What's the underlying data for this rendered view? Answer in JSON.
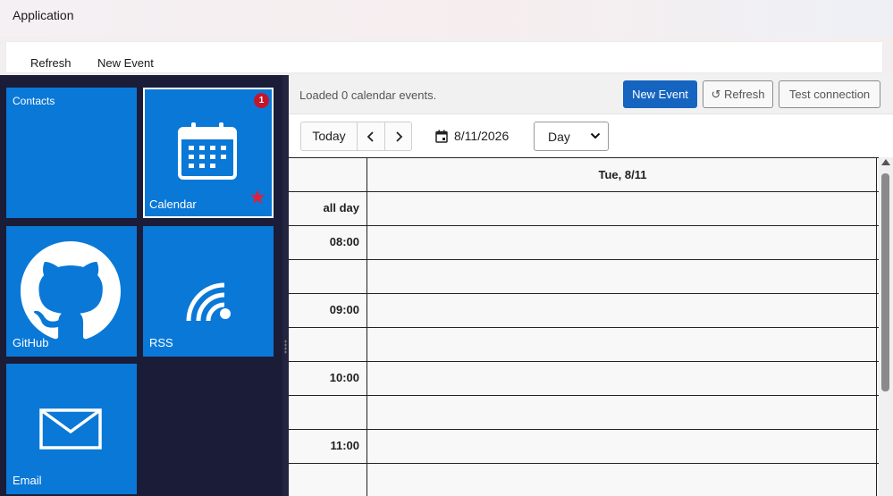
{
  "window": {
    "title": "Application"
  },
  "commandbar": {
    "refresh_label": "Refresh",
    "new_event_label": "New Event"
  },
  "tiles": {
    "contacts": {
      "label": "Contacts"
    },
    "calendar": {
      "label": "Calendar",
      "badge": "1"
    },
    "github": {
      "label": "GitHub"
    },
    "rss": {
      "label": "RSS"
    },
    "email": {
      "label": "Email"
    }
  },
  "calendar": {
    "status": "Loaded 0 calendar events.",
    "new_event_button": "New Event",
    "refresh_button": "↺ Refresh",
    "test_connection_button": "Test connection",
    "today_button": "Today",
    "prev_label": "‹",
    "next_label": "›",
    "date": "8/11/2026",
    "view": "Day",
    "day_header": "Tue, 8/11",
    "all_day_label": "all day",
    "hours": [
      "08:00",
      "09:00",
      "10:00",
      "11:00"
    ]
  },
  "colors": {
    "tile": "#0a78d7",
    "primary": "#1565c0",
    "badge": "#c4162a",
    "pane": "#1b1c38"
  },
  "icons": [
    "calendar-icon",
    "github-icon",
    "rss-icon",
    "email-icon",
    "star-icon",
    "date-picker-icon",
    "chevron-left-icon",
    "chevron-right-icon",
    "dropdown-chevron-icon"
  ]
}
